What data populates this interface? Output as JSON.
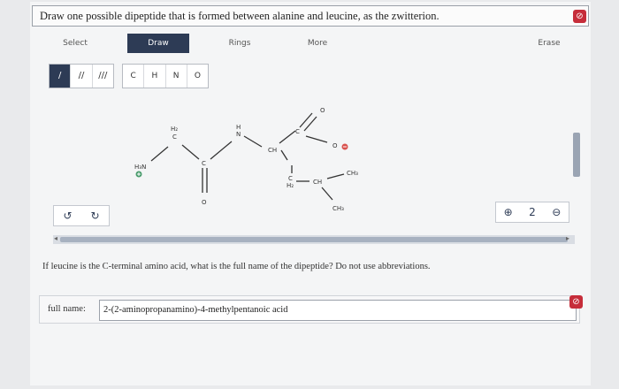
{
  "question": "Draw one possible dipeptide that is formed between alanine and leucine, as the zwitterion.",
  "toolbar": {
    "select": "Select",
    "draw": "Draw",
    "rings": "Rings",
    "more": "More",
    "erase": "Erase"
  },
  "bond_tools": [
    "/",
    "//",
    "///"
  ],
  "atom_tools": [
    "C",
    "H",
    "N",
    "O"
  ],
  "molecule_labels": {
    "h3n": "H₃N",
    "ch2_top": "H₂",
    "c_top": "C",
    "c_carbonyl": "C",
    "o_carbonyl": "O",
    "h_amide": "H",
    "n_amide": "N",
    "ch_alpha": "CH",
    "c_carboxyl": "C",
    "o_double": "O",
    "o_minus": "O",
    "c_side": "C",
    "h2_side": "H₂",
    "ch_branch": "CH",
    "ch3_a": "CH₃",
    "ch3_b": "CH₃"
  },
  "undo_buttons": [
    "↺",
    "↻"
  ],
  "zoom_buttons": [
    "⊕",
    "2",
    "⊖"
  ],
  "prompt": "If leucine is the C-terminal amino acid, what is the full name of the dipeptide? Do not use abbreviations.",
  "answer": {
    "label": "full name:",
    "value": "2-(2-aminopropanamino)-4-methylpentanoic acid"
  },
  "status_icon": "⊘",
  "colors": {
    "accent": "#2d3b55",
    "error": "#c62d3a",
    "plus": "#4a9c6d",
    "minus": "#d9534f"
  }
}
